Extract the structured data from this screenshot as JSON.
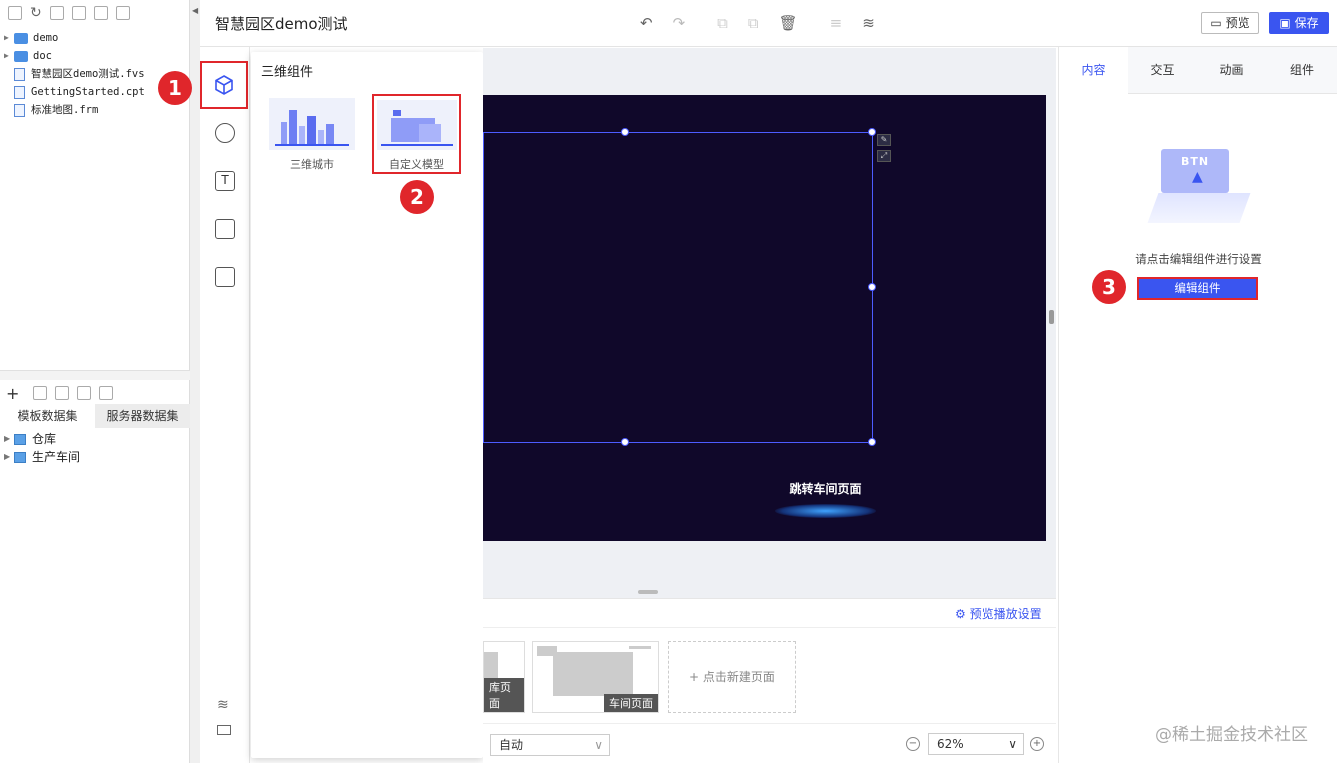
{
  "app_title": "智慧园区demo测试",
  "header": {
    "preview_label": "预览",
    "save_label": "保存"
  },
  "file_tree": [
    {
      "name": "demo",
      "type": "folder"
    },
    {
      "name": "doc",
      "type": "folder"
    },
    {
      "name": "智慧园区demo测试.fvs",
      "type": "file"
    },
    {
      "name": "GettingStarted.cpt",
      "type": "file"
    },
    {
      "name": "标准地图.frm",
      "type": "file"
    }
  ],
  "dataset_tabs": [
    "模板数据集",
    "服务器数据集"
  ],
  "datasets": [
    "仓库",
    "生产车间"
  ],
  "component_panel": {
    "title": "三维组件",
    "items": [
      "三维城市",
      "自定义模型"
    ]
  },
  "canvas": {
    "jump_button_label": "跳转车间页面"
  },
  "page_strip": {
    "preview_settings": "预览播放设置",
    "pages": [
      "库页面",
      "车间页面"
    ],
    "new_page": "点击新建页面"
  },
  "bottom_bar": {
    "layout_mode": "自动",
    "zoom": "62%"
  },
  "right_panel": {
    "tabs": [
      "内容",
      "交互",
      "动画",
      "组件"
    ],
    "active_tab": "内容",
    "illustration_text": "BTN",
    "hint": "请点击编辑组件进行设置",
    "edit_button": "编辑组件"
  },
  "callouts": [
    "1",
    "2",
    "3"
  ],
  "watermark": "@稀土掘金技术社区",
  "colors": {
    "accent": "#3a55f0",
    "canvas": "#10082a",
    "callout": "#e0262b"
  }
}
